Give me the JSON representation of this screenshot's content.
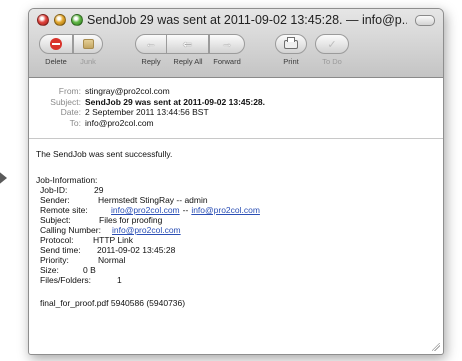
{
  "window": {
    "title": "SendJob 29 was sent at 2011-09-02 13:45:28. — info@p..."
  },
  "toolbar": {
    "delete": "Delete",
    "junk": "Junk",
    "reply": "Reply",
    "reply_all": "Reply All",
    "forward": "Forward",
    "print": "Print",
    "todo": "To Do"
  },
  "headers": {
    "from_label": "From:",
    "from_value": "stingray@pro2col.com",
    "subject_label": "Subject:",
    "subject_value": "SendJob 29 was sent at 2011-09-02 13:45:28.",
    "date_label": "Date:",
    "date_value": "2 September 2011 13:44:56 BST",
    "to_label": "To:",
    "to_value": "info@pro2col.com"
  },
  "body": {
    "message": "The SendJob was sent successfully.",
    "info_heading": "Job-Information:",
    "jobid_label": "Job-ID:",
    "jobid_value": "29",
    "sender_label": "Sender:",
    "sender_value": "Hermstedt StingRay -- admin",
    "remote_label": "Remote site:",
    "remote_link1": "info@pro2col.com",
    "remote_sep": "--",
    "remote_link2": "info@pro2col.com",
    "subject_label": "Subject:",
    "subject_value": "Files for proofing",
    "calling_label": "Calling Number:",
    "calling_value": "info@pro2col.com",
    "protocol_label": "Protocol:",
    "protocol_value": "HTTP Link",
    "sendtime_label": "Send time:",
    "sendtime_value": "2011-09-02 13:45:28",
    "priority_label": "Priority:",
    "priority_value": "Normal",
    "size_label": "Size:",
    "size_value": "0 B",
    "files_label": "Files/Folders:",
    "files_value": "1",
    "attachment": "final_for_proof.pdf 5940586 (5940736)"
  },
  "colors": {
    "link": "#2b4fb5",
    "close_light": "#e0443e",
    "minimize_light": "#e3a82f",
    "zoom_light": "#5fb745",
    "delete_icon": "#d9332b"
  }
}
